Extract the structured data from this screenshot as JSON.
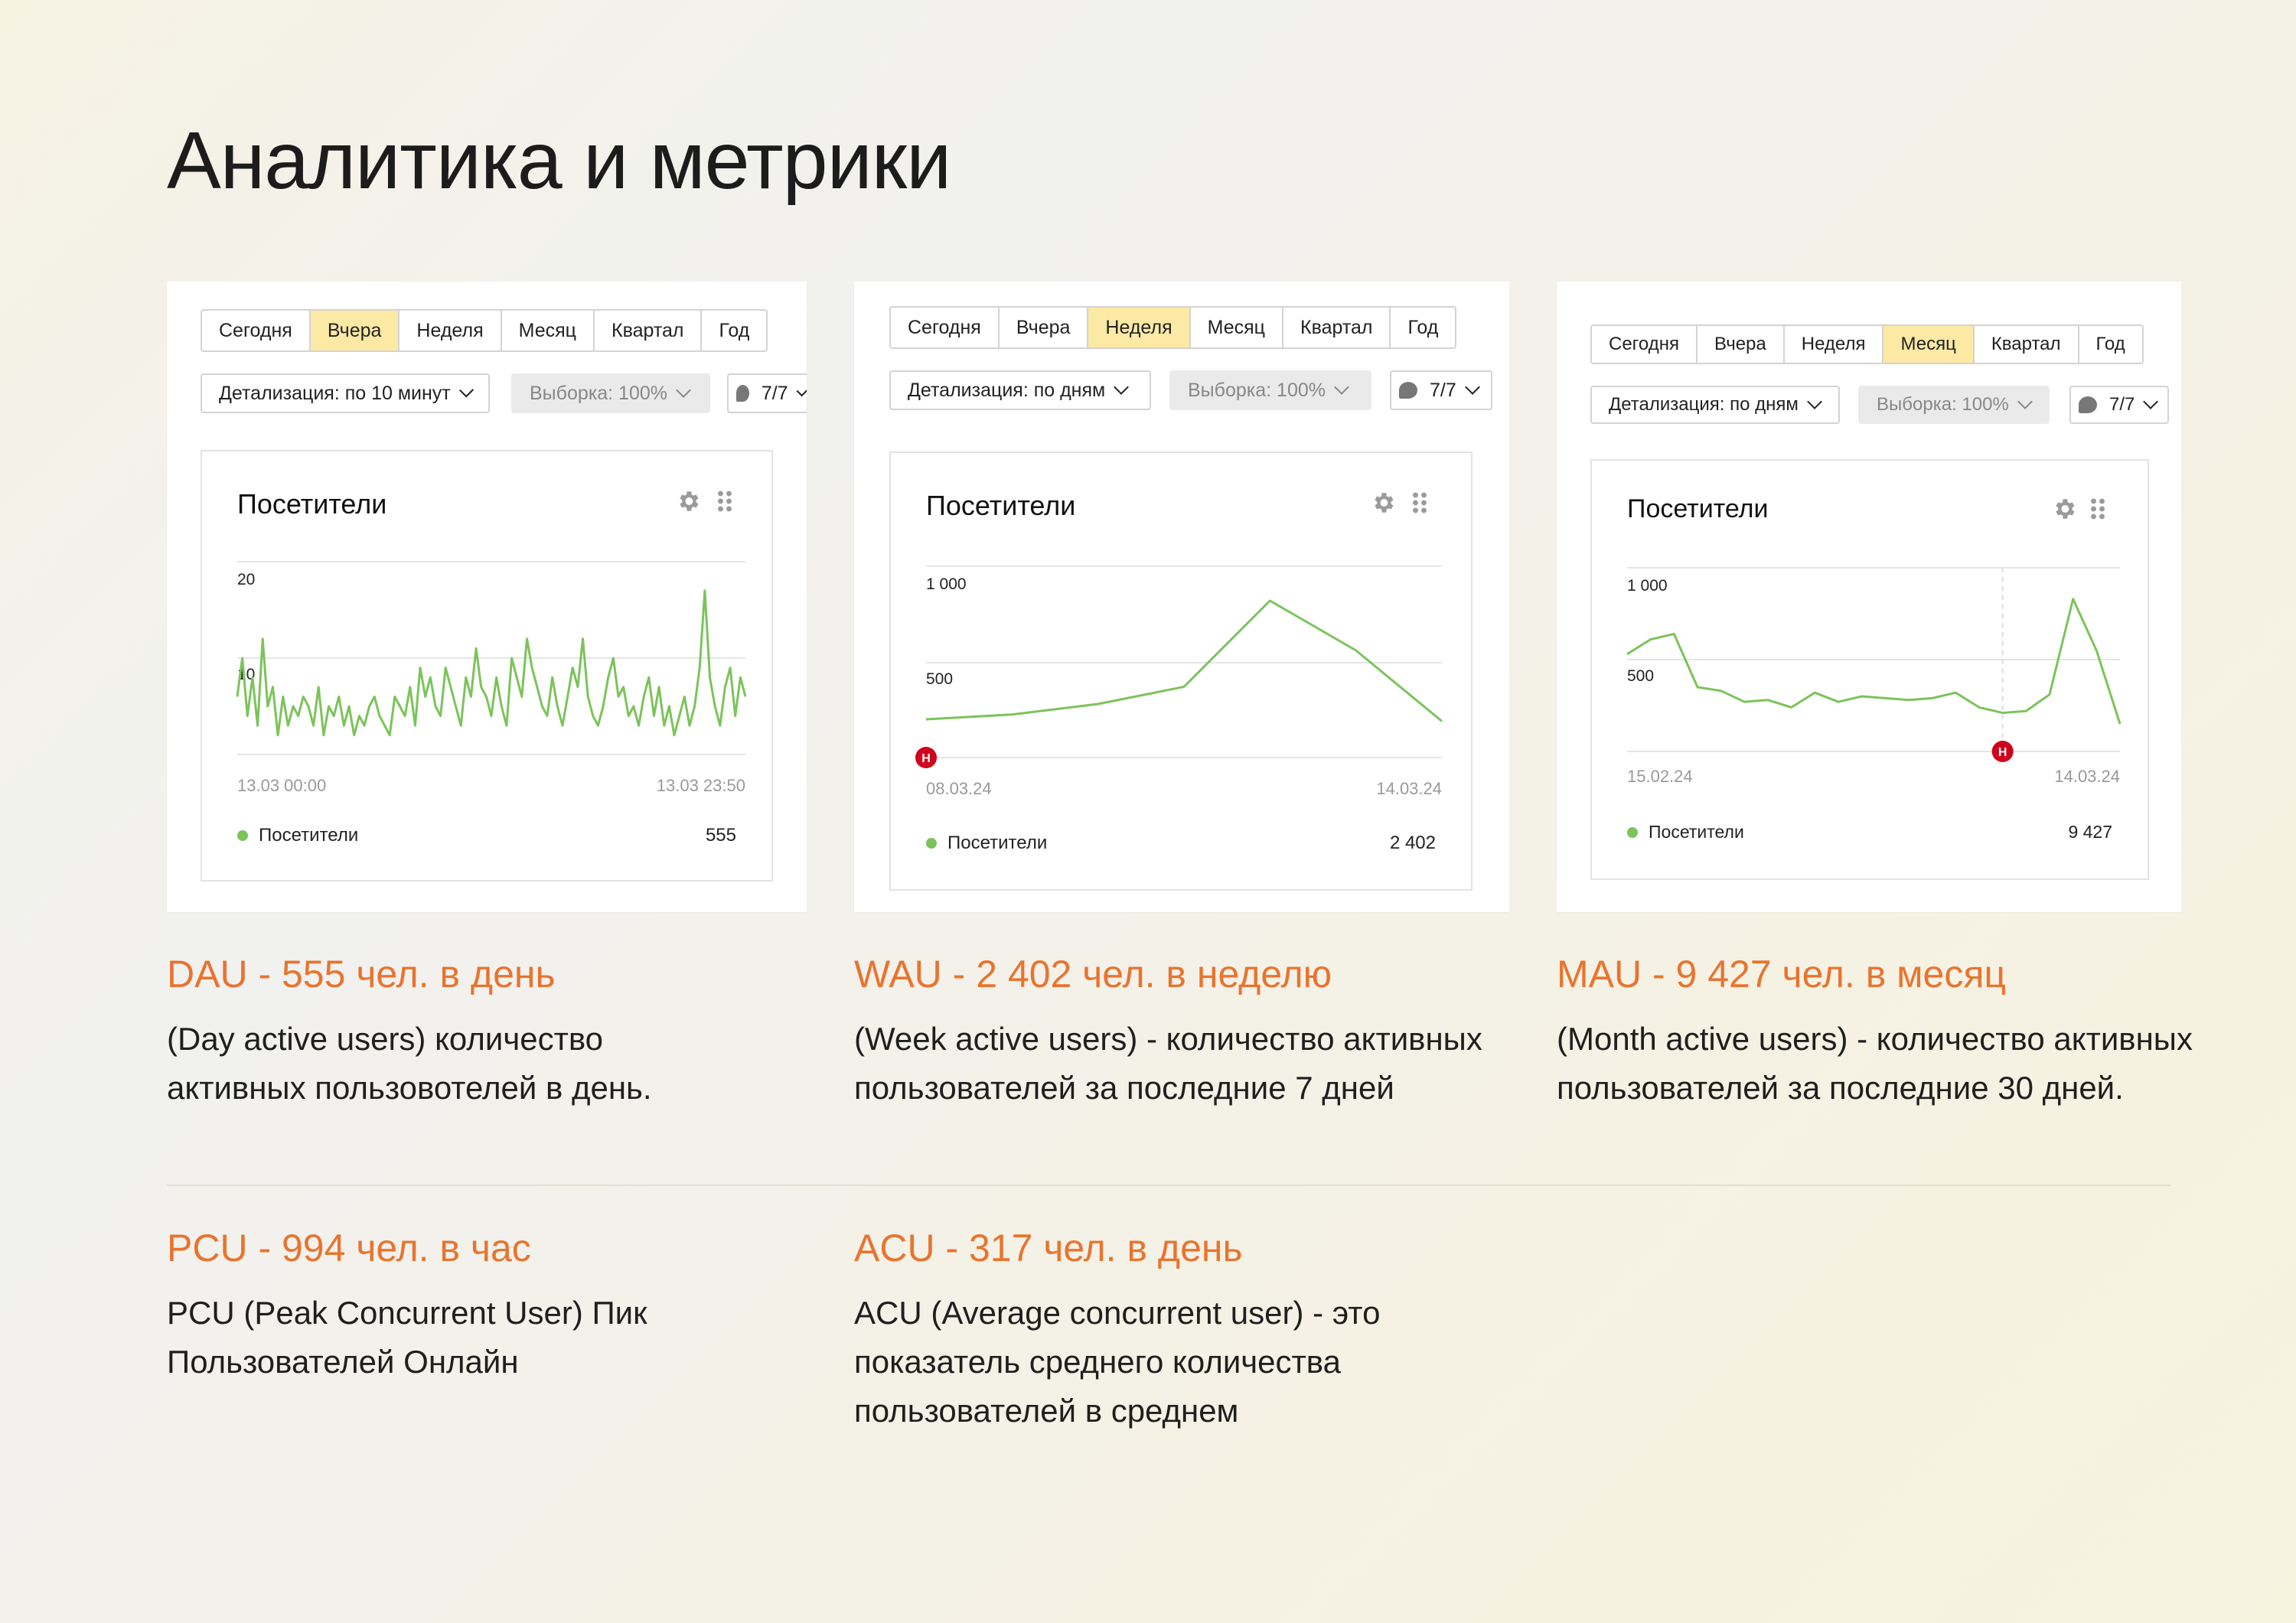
{
  "page_title": "Аналитика и метрики",
  "colors": {
    "accent": "#e8742f",
    "tab_active": "#fce9a4",
    "series": "#7cc35b",
    "marker": "#d0021b"
  },
  "icons": {
    "settings": "gear-icon",
    "drag": "grip-icon",
    "comment": "comment-bubble-icon",
    "dropdown": "chevron-down-icon"
  },
  "cards": [
    {
      "tabs": [
        "Сегодня",
        "Вчера",
        "Неделя",
        "Месяц",
        "Квартал",
        "Год"
      ],
      "active_tab": "Вчера",
      "detail": "Детализация: по 10 минут",
      "sample": "Выборка: 100%",
      "filter": "7/7",
      "panel_title": "Посетители",
      "y_ticks": [
        "20",
        "10"
      ],
      "x_start": "13.03 00:00",
      "x_end": "13.03 23:50",
      "legend": "Посетители",
      "total": "555"
    },
    {
      "tabs": [
        "Сегодня",
        "Вчера",
        "Неделя",
        "Месяц",
        "Квартал",
        "Год"
      ],
      "active_tab": "Неделя",
      "detail": "Детализация: по дням",
      "sample": "Выборка: 100%",
      "filter": "7/7",
      "panel_title": "Посетители",
      "y_ticks": [
        "1 000",
        "500"
      ],
      "x_start": "08.03.24",
      "x_end": "14.03.24",
      "legend": "Посетители",
      "total": "2 402",
      "marker": "Н"
    },
    {
      "tabs": [
        "Сегодня",
        "Вчера",
        "Неделя",
        "Месяц",
        "Квартал",
        "Год"
      ],
      "active_tab": "Месяц",
      "detail": "Детализация: по дням",
      "sample": "Выборка: 100%",
      "filter": "7/7",
      "panel_title": "Посетители",
      "y_ticks": [
        "1 000",
        "500"
      ],
      "x_start": "15.02.24",
      "x_end": "14.03.24",
      "legend": "Посетители",
      "total": "9 427",
      "marker": "Н"
    }
  ],
  "chart_data": [
    {
      "type": "line",
      "title": "Посетители",
      "x_labels": [
        "13.03 00:00",
        "13.03 23:50"
      ],
      "ylim": [
        0,
        20
      ],
      "series": [
        {
          "name": "Посетители",
          "values": [
            6,
            10,
            4,
            8,
            3,
            12,
            5,
            7,
            2,
            6,
            3,
            5,
            4,
            6,
            5,
            3,
            7,
            2,
            5,
            4,
            6,
            3,
            5,
            2,
            4,
            3,
            5,
            6,
            4,
            3,
            2,
            6,
            5,
            4,
            7,
            3,
            9,
            6,
            8,
            5,
            4,
            9,
            7,
            5,
            3,
            8,
            6,
            11,
            7,
            6,
            4,
            8,
            5,
            3,
            10,
            8,
            6,
            12,
            9,
            7,
            5,
            4,
            8,
            5,
            3,
            6,
            9,
            7,
            12,
            6,
            4,
            3,
            5,
            8,
            10,
            6,
            7,
            4,
            5,
            3,
            6,
            8,
            4,
            7,
            3,
            5,
            2,
            4,
            6,
            3,
            5,
            9,
            17,
            8,
            5,
            3,
            7,
            9,
            4,
            8,
            6
          ]
        }
      ],
      "total": 555
    },
    {
      "type": "line",
      "title": "Посетители",
      "x_labels": [
        "08.03.24",
        "14.03.24"
      ],
      "ylim": [
        0,
        1000
      ],
      "series": [
        {
          "name": "Посетители",
          "values": [
            200,
            225,
            280,
            370,
            820,
            560,
            190
          ]
        }
      ],
      "total": 2402
    },
    {
      "type": "line",
      "title": "Посетители",
      "x_labels": [
        "15.02.24",
        "14.03.24"
      ],
      "ylim": [
        0,
        1000
      ],
      "series": [
        {
          "name": "Посетители",
          "values": [
            530,
            610,
            640,
            350,
            330,
            270,
            280,
            240,
            320,
            270,
            300,
            290,
            280,
            290,
            320,
            240,
            210,
            220,
            310,
            830,
            550,
            150
          ]
        }
      ],
      "total": 9427
    }
  ],
  "metrics": [
    {
      "title": "DAU - 555 чел. в день",
      "desc": "(Day active users) количество активных пользовотелей в день."
    },
    {
      "title": "WAU - 2 402 чел. в неделю",
      "desc": "(Week active users) - количество активных пользователей за последние 7 дней"
    },
    {
      "title": "MAU - 9 427 чел. в месяц",
      "desc": "(Month active users) - количество активных пользователей за последние 30 дней."
    },
    {
      "title": "PCU - 994 чел. в час",
      "desc": "PCU (Peak Concurrent User) Пик Пользователей Онлайн"
    },
    {
      "title": "ACU - 317 чел. в день",
      "desc": "ACU (Average concurrent user) - это показатель среднего количества пользователей в среднем"
    }
  ]
}
